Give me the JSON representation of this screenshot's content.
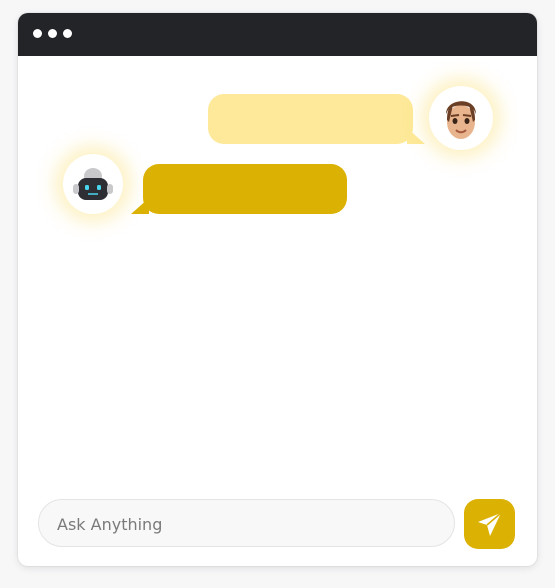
{
  "composer": {
    "placeholder": "Ask Anything"
  },
  "icons": {
    "user_avatar": "user-memoji-avatar",
    "bot_avatar": "robot-avatar",
    "send": "send-paper-plane-icon"
  },
  "colors": {
    "titlebar": "#232428",
    "user_bubble": "#fde999",
    "bot_bubble": "#dbb204",
    "send_button": "#dbb204"
  }
}
